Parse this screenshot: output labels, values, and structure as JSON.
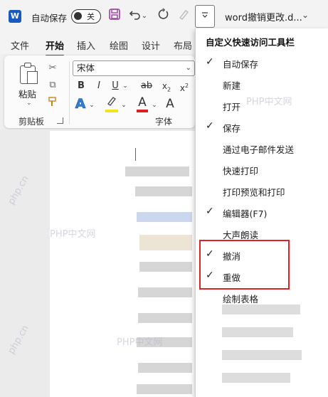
{
  "titlebar": {
    "app_logo": "W",
    "autosave_label": "自动保存",
    "autosave_state": "关",
    "doc_title": "word撤销更改.d...",
    "icons": [
      "word-logo-icon",
      "save-icon",
      "undo-icon",
      "redo-icon",
      "format-painter-icon",
      "customize-toolbar-icon",
      "chevron-down-icon"
    ]
  },
  "tabs": [
    {
      "label": "文件",
      "active": false
    },
    {
      "label": "开始",
      "active": true
    },
    {
      "label": "插入",
      "active": false
    },
    {
      "label": "绘图",
      "active": false
    },
    {
      "label": "设计",
      "active": false
    },
    {
      "label": "布局",
      "active": false
    }
  ],
  "ribbon": {
    "paste_label": "粘贴",
    "clipboard_group": "剪贴板",
    "font_group": "字体",
    "font_name": "宋体",
    "bold": "B",
    "italic": "I",
    "underline": "U",
    "strike": "ab",
    "subscript": "x",
    "superscript": "x",
    "text_effect": "A",
    "font_color": "A",
    "extra": "A"
  },
  "menu": {
    "title": "自定义快速访问工具栏",
    "items": [
      {
        "label": "自动保存",
        "checked": true
      },
      {
        "label": "新建",
        "checked": false
      },
      {
        "label": "打开",
        "checked": false
      },
      {
        "label": "保存",
        "checked": true
      },
      {
        "label": "通过电子邮件发送",
        "checked": false
      },
      {
        "label": "快速打印",
        "checked": false
      },
      {
        "label": "打印预览和打印",
        "checked": false
      },
      {
        "label": "编辑器(F7)",
        "checked": true
      },
      {
        "label": "大声朗读",
        "checked": false
      },
      {
        "label": "撤消",
        "checked": true
      },
      {
        "label": "重做",
        "checked": true
      },
      {
        "label": "绘制表格",
        "checked": false
      }
    ],
    "check_glyph": "✓"
  },
  "watermarks": [
    "PHP中文网",
    "PHP中文网",
    "PHP中文网",
    "php.cn",
    "php.cn"
  ],
  "colors": {
    "accent": "#185abd",
    "highlight_box": "#dd2222",
    "save_icon": "#9b3fa3"
  }
}
